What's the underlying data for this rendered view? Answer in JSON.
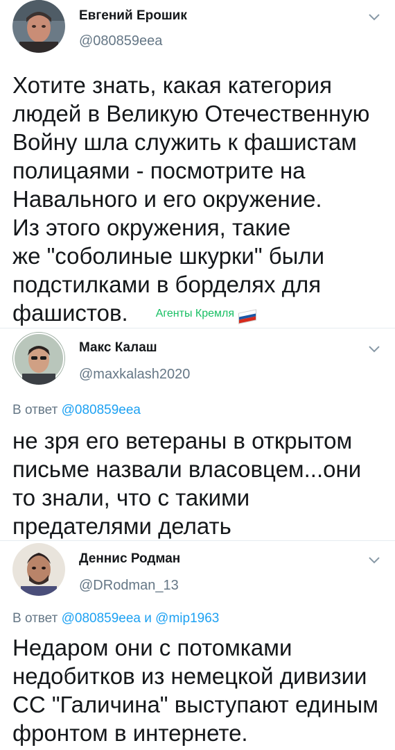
{
  "tweets": [
    {
      "name": "Евгений Ерошик",
      "handle": "@080859eea",
      "body_lines": [
        "Хотите знать, какая категория",
        "людей в Великую Отечественную",
        "Войну шла служить к фашистам",
        "полицаями - посмотрите на",
        "Навального и его окружение.",
        "Из этого окружения, такие",
        "же \"соболиные шкурки\" были",
        "подстилками в борделях для",
        "фашистов."
      ],
      "tag": "Агенты Кремля",
      "flag_colors": [
        "#ffffff",
        "#1c57a5",
        "#d52b1e"
      ]
    },
    {
      "name": "Макс Калаш",
      "handle": "@maxkalash2020",
      "reply_prefix": "В ответ ",
      "reply_mention_1": "@080859eea",
      "body_lines": [
        "не зря его ветераны в открытом",
        "письме назвали власовцем...они",
        "то знали, что с такими",
        "предателями делать"
      ]
    },
    {
      "name": "Деннис Родман",
      "handle": "@DRodman_13",
      "reply_prefix": "В ответ ",
      "reply_mention_1": "@080859eea",
      "reply_joiner": " и ",
      "reply_mention_2": "@mip1963",
      "body_lines": [
        "Недаром они с потомками",
        "недобитков из немецкой дивизии",
        "СС \"Галичина\" выступают единым",
        "фронтом в интернете."
      ]
    }
  ],
  "icons": {
    "menu": "chevron-down-icon"
  },
  "colors": {
    "link": "#1da1f2",
    "secondary": "#657786",
    "tag": "#17bf63"
  }
}
